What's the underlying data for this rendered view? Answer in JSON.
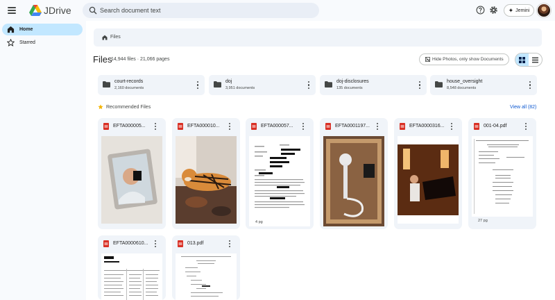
{
  "app": {
    "brand": "JDrive"
  },
  "search": {
    "placeholder": "Search document text"
  },
  "header": {
    "jemini_label": "Jemini"
  },
  "sidebar": {
    "items": [
      {
        "label": "Home",
        "icon": "home-icon",
        "active": true
      },
      {
        "label": "Starred",
        "icon": "star-icon",
        "active": false
      }
    ]
  },
  "breadcrumb": {
    "label": "Files"
  },
  "main": {
    "title": "Files",
    "subtitle": "14,944 files · 21,066 pages",
    "hide_photos_label": "Hide Photos, only show Documents",
    "view_mode": "grid"
  },
  "folders": [
    {
      "name": "court-records",
      "count": "2,160 documents"
    },
    {
      "name": "doj",
      "count": "3,951 documents"
    },
    {
      "name": "doj-disclosures",
      "count": "135 documents"
    },
    {
      "name": "house_oversight",
      "count": "8,548 documents"
    }
  ],
  "recommended": {
    "title": "Recommended Files",
    "view_all": "View all (82)",
    "files": [
      {
        "name": "EFTA000005...",
        "thumb": "photo-frame",
        "pages": ""
      },
      {
        "name": "EFTA000010...",
        "thumb": "photo-tiger",
        "pages": ""
      },
      {
        "name": "EFTA000057...",
        "thumb": "document-redacted",
        "pages": "4 pg"
      },
      {
        "name": "EFTA0001197...",
        "thumb": "photo-box",
        "pages": ""
      },
      {
        "name": "EFTA0000316...",
        "thumb": "photo-piano",
        "pages": ""
      },
      {
        "name": "001-04.pdf",
        "thumb": "document-court",
        "pages": "27 pg"
      },
      {
        "name": "EFTA0000610...",
        "thumb": "document-table",
        "pages": ""
      },
      {
        "name": "013.pdf",
        "thumb": "document-text",
        "pages": ""
      }
    ]
  },
  "colors": {
    "accent": "#0b57d0",
    "active_nav": "#c2e7ff",
    "panel": "#f0f4f9",
    "pdf_red": "#d93025",
    "star": "#f4b400"
  }
}
